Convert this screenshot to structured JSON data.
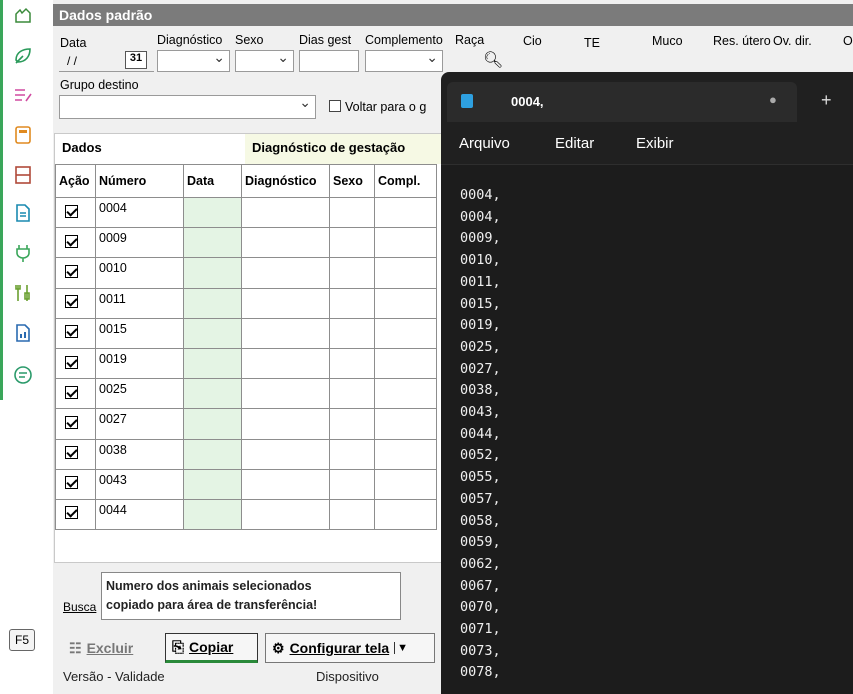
{
  "title": "Dados padrão",
  "fields": {
    "data_label": "Data",
    "data_value": "/ /",
    "calendar_day": "31",
    "diagnostico_label": "Diagnóstico",
    "sexo_label": "Sexo",
    "dias_gest_label": "Dias gest",
    "complemento_label": "Complemento",
    "raca_label": "Raça",
    "cio_label": "Cio",
    "te_label": "TE",
    "muco_label": "Muco",
    "res_utero_label": "Res. útero",
    "ov_dir_label": "Ov. dir.",
    "o_label": "O",
    "grupo_destino_label": "Grupo destino",
    "voltar_label": "Voltar para o g"
  },
  "grid": {
    "group_dados": "Dados",
    "group_diag": "Diagnóstico de gestação",
    "columns": [
      "Ação",
      "Número",
      "Data",
      "Diagnóstico",
      "Sexo",
      "Compl."
    ],
    "rows": [
      "0004",
      "0009",
      "0010",
      "0011",
      "0015",
      "0019",
      "0025",
      "0027",
      "0038",
      "0043",
      "0044"
    ]
  },
  "tooltip": {
    "line1": "Numero dos animais selecionados",
    "line2": "copiado para área de transferência!"
  },
  "busca_label": "Busca",
  "toolbar": {
    "excluir": "Excluir",
    "copiar": "Copiar",
    "configurar": "Configurar tela"
  },
  "footer": {
    "versao": "Versão - Validade",
    "dispositivo": "Dispositivo"
  },
  "sidebar": {
    "f5": "F5",
    "icons": [
      "cow-hand-icon",
      "leaf-icon",
      "list-edit-icon",
      "calculator-icon",
      "panel-icon",
      "document-icon",
      "plug-icon",
      "tools-icon",
      "report-icon",
      "chat-icon"
    ]
  },
  "notepad": {
    "tab_title": "0004,",
    "menu": [
      "Arquivo",
      "Editar",
      "Exibir"
    ],
    "lines": [
      "0004,",
      "0004,",
      "0009,",
      "0010,",
      "0011,",
      "0015,",
      "0019,",
      "0025,",
      "0027,",
      "0038,",
      "0043,",
      "0044,",
      "0052,",
      "0055,",
      "0057,",
      "0058,",
      "0059,",
      "0062,",
      "0067,",
      "0070,",
      "0071,",
      "0073,",
      "0078,"
    ]
  },
  "colors": {
    "title_bar": "#7b7b7b",
    "data_column": "#e4f4e4",
    "notepad_bg": "#202020",
    "sidebar_accent": "#3aa65a"
  }
}
